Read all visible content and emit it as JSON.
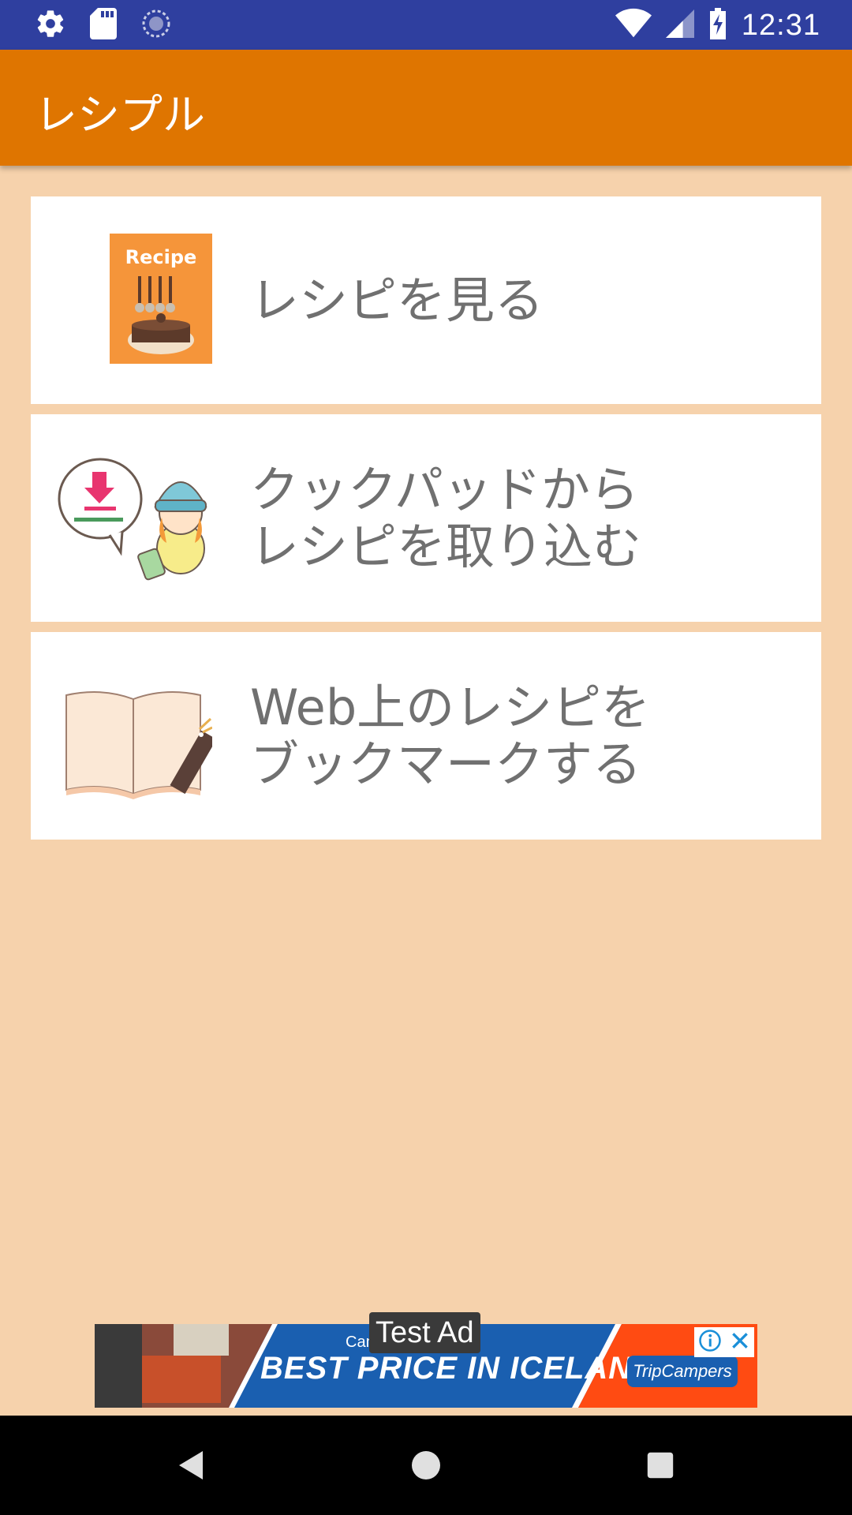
{
  "status_bar": {
    "time": "12:31",
    "icons": [
      "settings-icon",
      "sd-card-icon",
      "sync-icon",
      "wifi-icon",
      "signal-icon",
      "battery-charging-icon"
    ]
  },
  "app_bar": {
    "title": "レシプル"
  },
  "menu": {
    "items": [
      {
        "label": "レシピを見る",
        "icon": "recipe-book-icon",
        "icon_text": "Recipe"
      },
      {
        "label": "クックパッドから\nレシピを取り込む",
        "icon": "import-character-icon"
      },
      {
        "label": "Web上のレシピを\nブックマークする",
        "icon": "open-book-bookmark-icon"
      }
    ]
  },
  "ad": {
    "label": "Test Ad",
    "subtext": "Camp",
    "headline": "BEST PRICE IN ICELAND",
    "brand": "TripCampers",
    "colors": {
      "blue": "#1a5fb0",
      "orange": "#ff4b12"
    }
  },
  "nav_bar": {
    "buttons": [
      "back-icon",
      "home-icon",
      "recents-icon"
    ]
  },
  "colors": {
    "status_bar": "#2f3f9f",
    "app_bar": "#df7500",
    "background": "#f6d2ac",
    "card": "#ffffff",
    "label_text": "#707070"
  }
}
